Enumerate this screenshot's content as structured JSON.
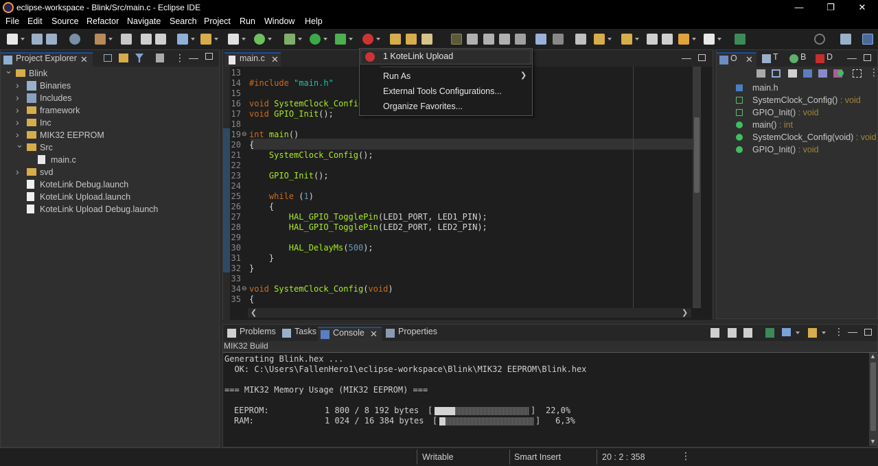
{
  "window": {
    "title": "eclipse-workspace - Blink/Src/main.c - Eclipse IDE",
    "minimize": "—",
    "restore": "❐",
    "close": "✕"
  },
  "menu": [
    "File",
    "Edit",
    "Source",
    "Refactor",
    "Navigate",
    "Search",
    "Project",
    "Run",
    "Window",
    "Help"
  ],
  "project_explorer": {
    "tab_label": "Project Explorer",
    "tree": [
      {
        "label": "Blink",
        "level": 0,
        "expanded": true,
        "icon": "project-icon"
      },
      {
        "label": "Binaries",
        "level": 1,
        "expanded": false,
        "icon": "binaries-icon"
      },
      {
        "label": "Includes",
        "level": 1,
        "expanded": false,
        "icon": "includes-icon"
      },
      {
        "label": "framework",
        "level": 1,
        "expanded": false,
        "icon": "folder-icon"
      },
      {
        "label": "Inc",
        "level": 1,
        "expanded": false,
        "icon": "folder-icon"
      },
      {
        "label": "MIK32 EEPROM",
        "level": 1,
        "expanded": false,
        "icon": "folder-icon"
      },
      {
        "label": "Src",
        "level": 1,
        "expanded": true,
        "icon": "folder-icon"
      },
      {
        "label": "main.c",
        "level": 2,
        "expanded": false,
        "icon": "c-file-icon"
      },
      {
        "label": "svd",
        "level": 1,
        "expanded": false,
        "icon": "folder-icon"
      },
      {
        "label": "KoteLink Debug.launch",
        "level": 1,
        "expanded": null,
        "icon": "launch-file-icon"
      },
      {
        "label": "KoteLink Upload.launch",
        "level": 1,
        "expanded": null,
        "icon": "launch-file-icon"
      },
      {
        "label": "KoteLink Upload Debug.launch",
        "level": 1,
        "expanded": null,
        "icon": "launch-file-icon"
      }
    ]
  },
  "editor": {
    "tab_label": "main.c",
    "lines": [
      {
        "n": "13",
        "html": ""
      },
      {
        "n": "14",
        "html": "<span class=\"kw\">#include</span> <span class=\"str\">\"main.h\"</span>"
      },
      {
        "n": "15",
        "html": ""
      },
      {
        "n": "16",
        "html": "<span class=\"kw\">void</span> <span class=\"fn\">SystemClock_Config</span>"
      },
      {
        "n": "17",
        "html": "<span class=\"kw\">void</span> <span class=\"fn\">GPIO_Init</span>();"
      },
      {
        "n": "18",
        "html": ""
      },
      {
        "n": "19",
        "html": "<span class=\"kw\">int</span> <span class=\"fn\">main</span>()"
      },
      {
        "n": "20",
        "html": "{"
      },
      {
        "n": "21",
        "html": "    <span class=\"fn\">SystemClock_Config</span>();"
      },
      {
        "n": "22",
        "html": ""
      },
      {
        "n": "23",
        "html": "    <span class=\"fn\">GPIO_Init</span>();"
      },
      {
        "n": "24",
        "html": ""
      },
      {
        "n": "25",
        "html": "    <span class=\"kw\">while</span> (<span class=\"num\">1</span>)"
      },
      {
        "n": "26",
        "html": "    {"
      },
      {
        "n": "27",
        "html": "        <span class=\"fn\">HAL_GPIO_TogglePin</span>(LED1_PORT, LED1_PIN);"
      },
      {
        "n": "28",
        "html": "        <span class=\"fn\">HAL_GPIO_TogglePin</span>(LED2_PORT, LED2_PIN);"
      },
      {
        "n": "29",
        "html": ""
      },
      {
        "n": "30",
        "html": "        <span class=\"fn\">HAL_DelayMs</span>(<span class=\"num\">500</span>);"
      },
      {
        "n": "31",
        "html": "    }"
      },
      {
        "n": "32",
        "html": "}"
      },
      {
        "n": "33",
        "html": ""
      },
      {
        "n": "34",
        "html": "<span class=\"kw\">void</span> <span class=\"fn\">SystemClock_Config</span>(<span class=\"kw\">void</span>)"
      },
      {
        "n": "35",
        "html": "{"
      }
    ]
  },
  "run_dropdown": {
    "items": [
      "1 KoteLink Upload",
      "Run As",
      "External Tools Configurations...",
      "Organize Favorites..."
    ]
  },
  "outline": {
    "tabs": [
      "O",
      "T",
      "B",
      "D"
    ],
    "items": [
      {
        "label": "main.h",
        "suffix": "",
        "icon": "include-icon"
      },
      {
        "label": "SystemClock_Config()",
        "suffix": " : void",
        "icon": "function-declaration-icon"
      },
      {
        "label": "GPIO_Init()",
        "suffix": " : void",
        "icon": "function-declaration-icon"
      },
      {
        "label": "main()",
        "suffix": " : int",
        "icon": "function-icon"
      },
      {
        "label": "SystemClock_Config(void)",
        "suffix": " : void",
        "icon": "function-icon"
      },
      {
        "label": "GPIO_Init()",
        "suffix": " : void",
        "icon": "function-icon"
      }
    ]
  },
  "bottom_panel": {
    "tabs": [
      "Problems",
      "Tasks",
      "Console",
      "Properties"
    ],
    "console_name": "MIK32 Build",
    "lines": [
      "Generating Blink.hex ...",
      "  OK: C:\\Users\\FallenHero1\\eclipse-workspace\\Blink\\MIK32 EEPROM\\Blink.hex",
      "",
      "=== MIK32 Memory Usage (MIK32 EEPROM) ===",
      ""
    ],
    "memory": [
      {
        "label": "EEPROM:",
        "usage": "1 800 / 8 192 bytes",
        "percent": "22,0%",
        "fraction": 0.22
      },
      {
        "label": "RAM:",
        "usage": "1 024 / 16 384 bytes",
        "percent": "6,3%",
        "fraction": 0.063
      }
    ]
  },
  "status": {
    "writable": "Writable",
    "insert_mode": "Smart Insert",
    "position": "20 : 2 : 358"
  }
}
